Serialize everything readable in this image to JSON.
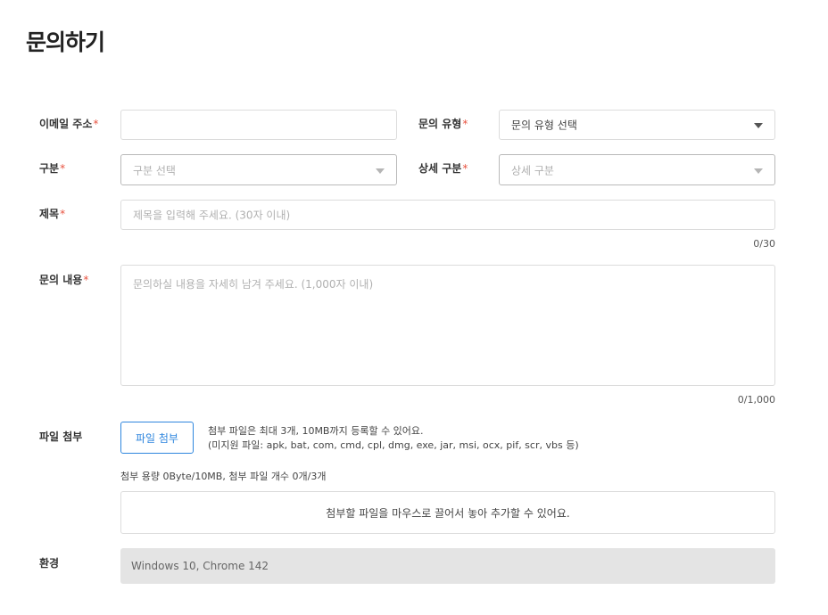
{
  "page_title": "문의하기",
  "required_mark": "*",
  "email": {
    "label": "이메일 주소",
    "value": ""
  },
  "inquiry_type": {
    "label": "문의 유형",
    "selected": "문의 유형 선택"
  },
  "category": {
    "label": "구분",
    "selected": "구분 선택"
  },
  "detail_category": {
    "label": "상세 구분",
    "selected": "상세 구분"
  },
  "subject": {
    "label": "제목",
    "placeholder": "제목을 입력해 주세요. (30자 이내)",
    "counter": "0/30"
  },
  "content": {
    "label": "문의 내용",
    "placeholder": "문의하실 내용을 자세히 남겨 주세요. (1,000자 이내)",
    "counter": "0/1,000"
  },
  "attachment": {
    "label": "파일 첨부",
    "button_label": "파일 첨부",
    "hint_line1": "첨부 파일은 최대 3개, 10MB까지 등록할 수 있어요.",
    "hint_line2": "(미지원 파일: apk, bat, com, cmd, cpl, dmg, exe, jar, msi, ocx, pif, scr, vbs 등)",
    "capacity": "첨부 용량 0Byte/10MB, 첨부 파일 개수 0개/3개",
    "dropzone_text": "첨부할 파일을 마우스로 끌어서 놓아 추가할 수 있어요."
  },
  "environment": {
    "label": "환경",
    "value": "Windows 10, Chrome 142"
  },
  "colors": {
    "required": "#e8523f",
    "accent": "#2e86de",
    "env_bg": "#e4e4e4"
  },
  "icons": {
    "dropdown": "caret-down-icon"
  }
}
